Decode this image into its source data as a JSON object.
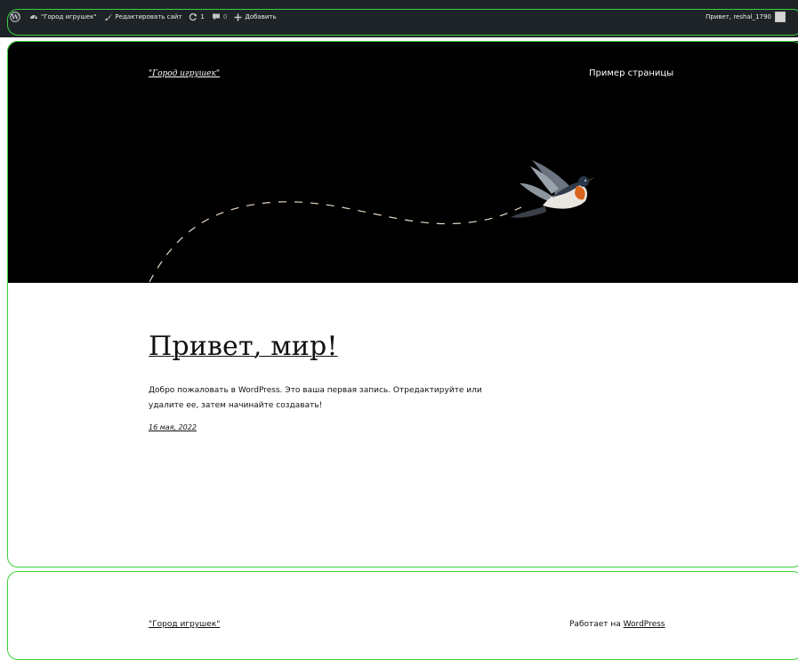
{
  "admin_bar": {
    "site_name": "\"Город игрушек\"",
    "edit_site": "Редактировать сайт",
    "updates_count": "1",
    "comments_count": "0",
    "add_new": "Добавить",
    "greeting": "Привет, reshal_1790"
  },
  "header": {
    "site_title": "\"Город игрушек\"",
    "nav": [
      "Пример страницы"
    ]
  },
  "post": {
    "title": "Привет, мир!",
    "excerpt": "Добро пожаловать в WordPress. Это ваша первая запись. Отредактируйте или удалите ее, затем начинайте создавать!",
    "date": "16 мая, 2022"
  },
  "footer": {
    "site_title": "\"Город игрушек\"",
    "credit_prefix": "Работает на ",
    "credit_link": "WordPress"
  },
  "colors": {
    "admin_bar_bg": "#1d2327",
    "header_bg": "#000000",
    "highlight_frame": "#3bd13b",
    "text": "#111111"
  },
  "icons": [
    "wordpress-logo-icon",
    "dashboard-icon",
    "brush-icon",
    "updates-icon",
    "comment-icon",
    "plus-icon",
    "bird-illustration"
  ]
}
